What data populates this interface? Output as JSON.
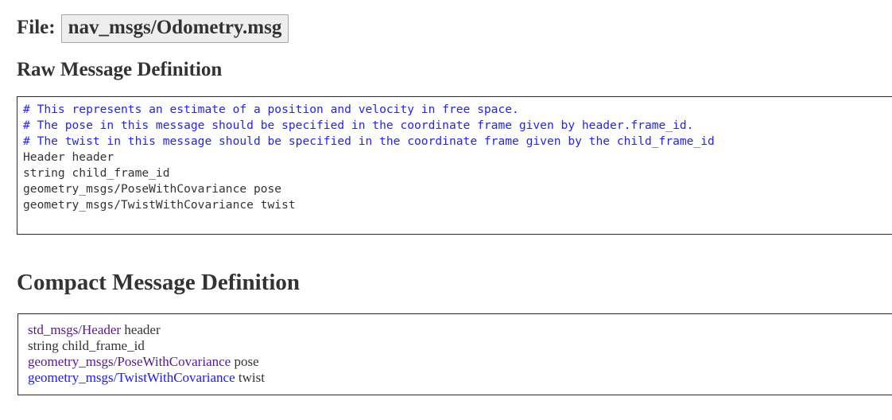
{
  "file": {
    "label": "File:",
    "name": "nav_msgs/Odometry.msg"
  },
  "sections": {
    "raw_title": "Raw Message Definition",
    "compact_title": "Compact Message Definition"
  },
  "raw_definition": {
    "lines": [
      {
        "kind": "comment",
        "text": "# This represents an estimate of a position and velocity in free space."
      },
      {
        "kind": "comment",
        "text": "# The pose in this message should be specified in the coordinate frame given by header.frame_id."
      },
      {
        "kind": "comment",
        "text": "# The twist in this message should be specified in the coordinate frame given by the child_frame_id"
      },
      {
        "kind": "code",
        "text": "Header header"
      },
      {
        "kind": "code",
        "text": "string child_frame_id"
      },
      {
        "kind": "code",
        "text": "geometry_msgs/PoseWithCovariance pose"
      },
      {
        "kind": "code",
        "text": "geometry_msgs/TwistWithCovariance twist"
      }
    ],
    "full_text": "# This represents an estimate of a position and velocity in free space.\n# The pose in this message should be specified in the coordinate frame given by header.frame_id.\n# The twist in this message should be specified in the coordinate frame given by the child_frame_id\nHeader header\nstring child_frame_id\ngeometry_msgs/PoseWithCovariance pose\ngeometry_msgs/TwistWithCovariance twist"
  },
  "compact_definition": {
    "lines": [
      {
        "link": "std_msgs/Header",
        "link_state": "visited",
        "field": " header"
      },
      {
        "link": "",
        "link_state": "none",
        "field": "string child_frame_id"
      },
      {
        "link": "geometry_msgs/PoseWithCovariance",
        "link_state": "visited",
        "field": " pose"
      },
      {
        "link": "geometry_msgs/TwistWithCovariance",
        "link_state": "unvisited",
        "field": " twist"
      }
    ]
  },
  "colors": {
    "comment": "#2424ee",
    "link_unvisited": "#1a1aee",
    "link_visited": "#551a8b",
    "text": "#333333",
    "box_border": "#2b2b2b",
    "filename_bg": "#eeeeee",
    "filename_border": "#aaaaaa"
  }
}
